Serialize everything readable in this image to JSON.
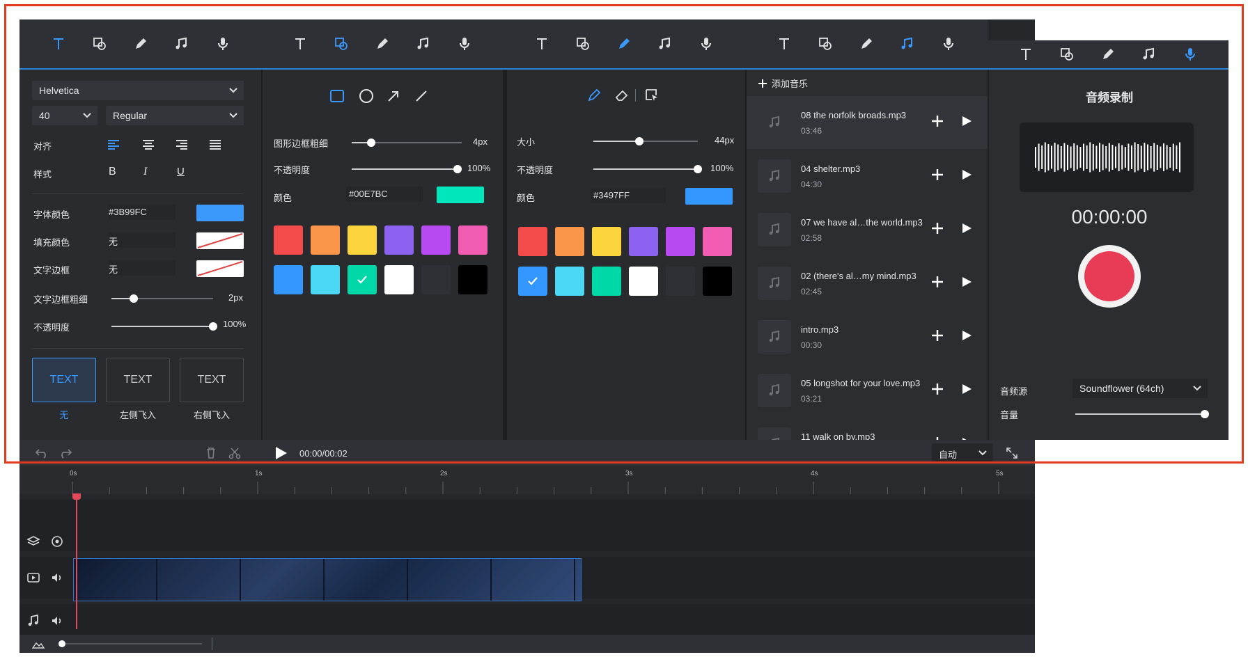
{
  "toolbar": {
    "icons": [
      "text-icon",
      "shape-icon",
      "pencil-icon",
      "music-icon",
      "microphone-icon"
    ]
  },
  "text_panel": {
    "font_family": "Helvetica",
    "font_size": "40",
    "font_weight": "Regular",
    "align_label": "对齐",
    "style_label": "样式",
    "style_bold": "B",
    "style_italic": "I",
    "style_underline": "U",
    "font_color_label": "字体颜色",
    "font_color_value": "#3B99FC",
    "fill_color_label": "填充颜色",
    "fill_color_value": "无",
    "border_label": "文字边框",
    "border_value": "无",
    "border_width_label": "文字边框粗细",
    "border_width_value": "2px",
    "border_width_fraction": 0.22,
    "opacity_label": "不透明度",
    "opacity_value": "100%",
    "animations": [
      {
        "text": "TEXT",
        "label": "无",
        "selected": true
      },
      {
        "text": "TEXT",
        "label": "左侧飞入",
        "selected": false
      },
      {
        "text": "TEXT",
        "label": "右侧飞入",
        "selected": false
      }
    ],
    "font_color_hex": "#3B99FC"
  },
  "shape_panel": {
    "border_width_label": "图形边框粗细",
    "border_width_value": "4px",
    "border_width_fraction": 0.18,
    "opacity_label": "不透明度",
    "opacity_value": "100%",
    "color_label": "颜色",
    "color_value": "#00E7BC",
    "color_hex": "#00E7BC",
    "checked_index": 8
  },
  "pen_panel": {
    "size_label": "大小",
    "size_value": "44px",
    "size_fraction": 0.44,
    "opacity_label": "不透明度",
    "opacity_value": "100%",
    "color_label": "颜色",
    "color_value": "#3497FF",
    "color_hex": "#3497FF",
    "checked_index": 6
  },
  "palette": [
    "#f34a4a",
    "#fa954a",
    "#fcd43c",
    "#8c63f0",
    "#b84af2",
    "#f35cb3",
    "#3497ff",
    "#4ad8f5",
    "#00d8a8",
    "#ffffff",
    "#2f3035",
    "#000000"
  ],
  "music_panel": {
    "add_label": "添加音乐",
    "items": [
      {
        "name": "08 the norfolk broads.mp3",
        "duration": "03:46"
      },
      {
        "name": "04 shelter.mp3",
        "duration": "04:30"
      },
      {
        "name": "07 we have al…the world.mp3",
        "duration": "02:58"
      },
      {
        "name": "02 (there's al…my mind.mp3",
        "duration": "02:45"
      },
      {
        "name": "intro.mp3",
        "duration": "00:30"
      },
      {
        "name": "05 longshot for your love.mp3",
        "duration": "03:21"
      },
      {
        "name": "11 walk on by.mp3",
        "duration": ""
      }
    ]
  },
  "record_panel": {
    "title": "音频录制",
    "time": "00:00:00",
    "source_label": "音频源",
    "source_value": "Soundflower (64ch)",
    "volume_label": "音量",
    "volume_fraction": 1.0
  },
  "playback": {
    "time": "00:00/00:02",
    "zoom_value": "自动"
  },
  "ruler": {
    "ticks": [
      "0s",
      "1s",
      "2s",
      "3s",
      "4s",
      "5s"
    ]
  }
}
